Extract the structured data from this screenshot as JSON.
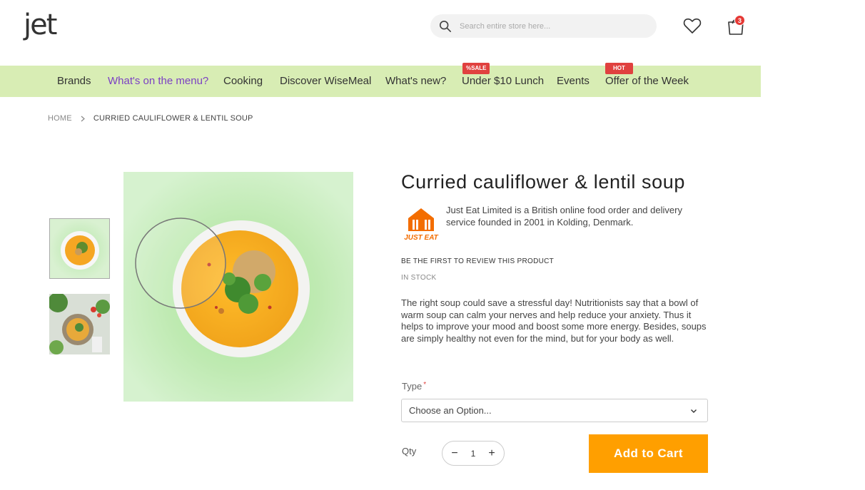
{
  "header": {
    "logo_text": "jet",
    "search_placeholder": "Search entire store here...",
    "cart_count": "3"
  },
  "nav": {
    "items": [
      {
        "label": "Brands"
      },
      {
        "label": "What's on the menu?"
      },
      {
        "label": "Cooking"
      },
      {
        "label": "Discover WiseMeal"
      },
      {
        "label": "What's new?"
      },
      {
        "label": "Under $10 Lunch",
        "tag": "%SALE"
      },
      {
        "label": "Events"
      },
      {
        "label": "Offer of the Week",
        "tag": "HOT"
      }
    ],
    "active_item": "What's on the menu?",
    "bg_color": "#d8edb4",
    "active_color": "#7b3fc4",
    "tag_color": "#e0413f"
  },
  "breadcrumb": {
    "home": "HOME",
    "current": "CURRIED CAULIFLOWER & LENTIL SOUP"
  },
  "product": {
    "title": "Curried cauliflower & lentil soup",
    "brand_logo_text": "JUST EAT",
    "brand_description": "Just Eat Limited is a British online food order and delivery service founded in 2001 in Kolding, Denmark.",
    "review_text": "BE THE FIRST TO REVIEW THIS PRODUCT",
    "stock_status": "IN STOCK",
    "description": "The right soup could save a stressful day! Nutritionists say that a bowl of warm soup can calm your nerves and help reduce your anxiety. Thus it helps to improve your mood and boost some more energy. Besides, soups are simply healthy not even for the mind, but for your body as well.",
    "type_label": "Type",
    "type_required_mark": "*",
    "type_placeholder": "Choose an Option...",
    "qty_label": "Qty",
    "qty_value": "1",
    "qty_minus": "−",
    "qty_plus": "+",
    "add_to_cart_label": "Add to Cart",
    "accent_color": "#ff9f00"
  }
}
